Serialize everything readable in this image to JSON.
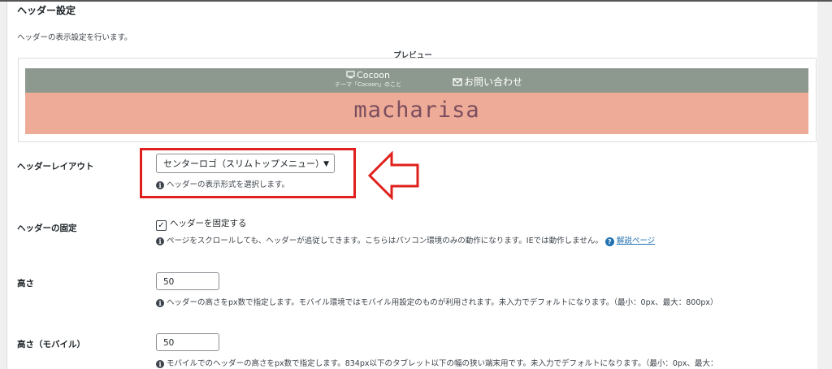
{
  "section": {
    "title": "ヘッダー設定",
    "description": "ヘッダーの表示設定を行います。"
  },
  "preview": {
    "label": "プレビュー",
    "nav_site_name": "Cocoon",
    "nav_site_sub": "テーマ「Cocoon」のこと",
    "nav_contact": "お問い合わせ",
    "logo_text": "macharisa",
    "colors": {
      "nav_bg": "#8d998f",
      "logo_bg": "#eeab98",
      "logo_text": "#7b4e5e"
    }
  },
  "layout": {
    "label": "ヘッダーレイアウト",
    "selected": "センターロゴ（スリムトップメニュー）",
    "hint": "ヘッダーの表示形式を選択します。"
  },
  "fixed": {
    "label": "ヘッダーの固定",
    "checkbox_label": "ヘッダーを固定する",
    "checked": true,
    "hint": "ページをスクロールしても、ヘッダーが追従してきます。こちらはパソコン環境のみの動作になります。IEでは動作しません。",
    "help_link": "解説ページ"
  },
  "height": {
    "label": "高さ",
    "value": "50",
    "hint": "ヘッダーの高さをpx数で指定します。モバイル環境ではモバイル用設定のものが利用されます。未入力でデフォルトになります。（最小：0px、最大：800px）"
  },
  "height_mobile": {
    "label": "高さ（モバイル）",
    "value": "50",
    "hint": "モバイルでのヘッダーの高さをpx数で指定します。834px以下のタブレット以下の幅の狭い端末用です。未入力でデフォルトになります。（最小：0px、最大："
  },
  "annotation": {
    "color": "#e0201c"
  }
}
